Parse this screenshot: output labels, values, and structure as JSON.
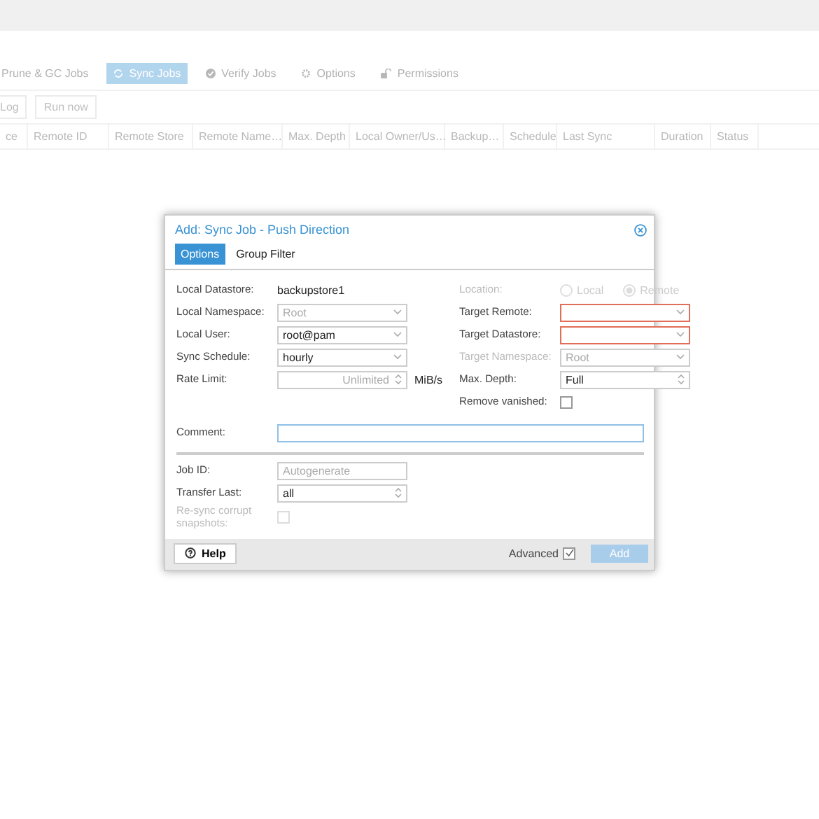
{
  "background": {
    "tabs": [
      {
        "label": "Prune & GC Jobs",
        "selected": false
      },
      {
        "label": "Sync Jobs",
        "selected": true
      },
      {
        "label": "Verify Jobs",
        "selected": false
      },
      {
        "label": "Options",
        "selected": false
      },
      {
        "label": "Permissions",
        "selected": false
      }
    ],
    "toolbar": [
      "Log",
      "Run now"
    ],
    "columns": [
      "ce",
      "Remote ID",
      "Remote Store",
      "Remote Name…",
      "Max. Depth",
      "Local Owner/Us…",
      "Backup…",
      "Schedule",
      "Last Sync",
      "Duration",
      "Status"
    ]
  },
  "dialog": {
    "title": "Add: Sync Job - Push Direction",
    "tabs": [
      {
        "label": "Options",
        "selected": true
      },
      {
        "label": "Group Filter",
        "selected": false
      }
    ],
    "left": [
      {
        "kind": "static",
        "label": "Local Datastore:",
        "value": "backupstore1",
        "disabled": false
      },
      {
        "kind": "combo",
        "label": "Local Namespace:",
        "placeholder": "Root",
        "disabled": false,
        "invalid": false
      },
      {
        "kind": "combo",
        "label": "Local User:",
        "value": "root@pam",
        "disabled": false,
        "invalid": false
      },
      {
        "kind": "combo",
        "label": "Sync Schedule:",
        "value": "hourly",
        "disabled": false,
        "invalid": false
      },
      {
        "kind": "spinner",
        "label": "Rate Limit:",
        "placeholder": "Unlimited",
        "unit": "MiB/s",
        "disabled": false
      }
    ],
    "right": [
      {
        "kind": "radio",
        "label": "Location:",
        "disabled": true,
        "options": [
          {
            "label": "Local",
            "selected": false
          },
          {
            "label": "Remote",
            "selected": true
          }
        ]
      },
      {
        "kind": "combo",
        "label": "Target Remote:",
        "disabled": false,
        "invalid": true
      },
      {
        "kind": "combo",
        "label": "Target Datastore:",
        "disabled": false,
        "invalid": true
      },
      {
        "kind": "combo",
        "label": "Target Namespace:",
        "placeholder": "Root",
        "disabled": true,
        "invalid": false
      },
      {
        "kind": "spinner",
        "label": "Max. Depth:",
        "value": "Full",
        "disabled": false
      },
      {
        "kind": "checkbox",
        "label": "Remove vanished:",
        "checked": false,
        "disabled": false
      }
    ],
    "comment": {
      "label": "Comment:",
      "focused": true
    },
    "lower": [
      {
        "kind": "text",
        "label": "Job ID:",
        "placeholder": "Autogenerate",
        "disabled": false
      },
      {
        "kind": "spinner",
        "label": "Transfer Last:",
        "value": "all",
        "disabled": false
      },
      {
        "kind": "checkbox",
        "label": "Re-sync corrupt snapshots:",
        "checked": false,
        "disabled": true
      }
    ],
    "footer": {
      "help": "Help",
      "advanced": {
        "label": "Advanced",
        "checked": true
      },
      "submit": {
        "label": "Add",
        "disabled": true
      }
    }
  }
}
